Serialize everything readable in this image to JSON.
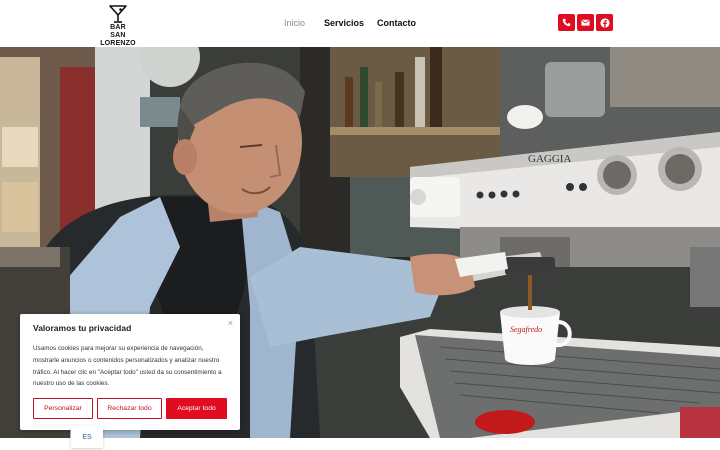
{
  "header": {
    "logo": {
      "line1": "BAR",
      "line2": "SAN LORENZO",
      "icon": "martini-glass-icon"
    },
    "nav": [
      {
        "label": "Inicio",
        "active": true
      },
      {
        "label": "Servicios",
        "active": false
      },
      {
        "label": "Contacto",
        "active": false
      }
    ],
    "social": [
      {
        "icon": "phone-icon"
      },
      {
        "icon": "email-icon"
      },
      {
        "icon": "facebook-icon"
      }
    ],
    "accent_color": "#e00c1f"
  },
  "hero": {
    "machine_brand": "GAGGIA",
    "cup_brand": "Segafredo",
    "description_icon": "barista-photo"
  },
  "cookie_banner": {
    "title": "Valoramos tu privacidad",
    "text": "Usamos cookies para mejorar su experiencia de navegación, mostrarle anuncios o contenidos personalizados y analizar nuestro tráfico. Al hacer clic en \"Aceptar todo\" usted da su consentimiento a nuestro uso de las cookies.",
    "close": "×",
    "buttons": {
      "customize": "Personalizar",
      "reject": "Rechazar todo",
      "accept": "Aceptar todo"
    }
  },
  "language": "ES"
}
